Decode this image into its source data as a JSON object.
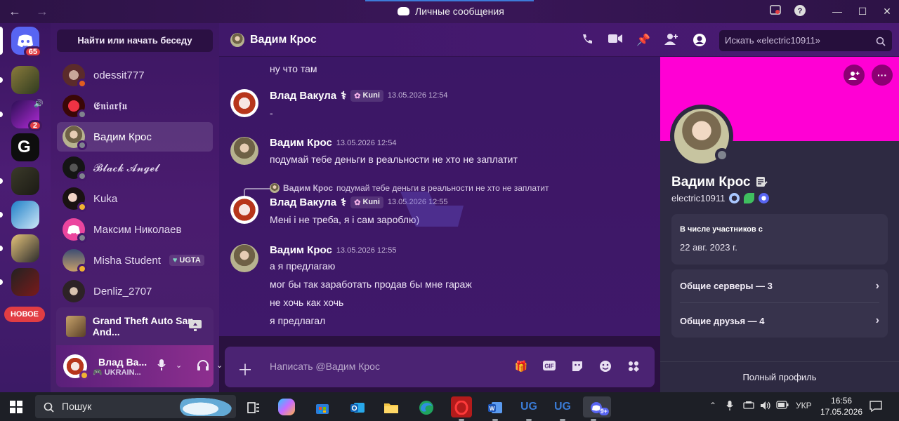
{
  "window": {
    "title": "Личные сообщения",
    "nav_back": "←",
    "nav_forward": "→"
  },
  "servers": {
    "home_badge": "65",
    "unread_badge": "2",
    "new_label": "НОВОЕ"
  },
  "dm_sidebar": {
    "search_label": "Найти или начать беседу",
    "items": [
      {
        "name": "odessit777"
      },
      {
        "name": "𝕰𝖓𝖎𝖆𝖗𝖋𝖚"
      },
      {
        "name": "Вадим Крос"
      },
      {
        "name": "𝓑𝓵𝓪𝓬𝓴 𝓐𝓷𝓰𝓮𝓵"
      },
      {
        "name": "Kuka"
      },
      {
        "name": "Максим Николаев"
      },
      {
        "name": "Misha Student",
        "tag": "UGTA"
      },
      {
        "name": "Denliz_2707"
      }
    ],
    "activity": "Grand Theft Auto San And...",
    "user": {
      "name": "Влад Ва...",
      "status": "UKRAIN..."
    }
  },
  "chat": {
    "recipient": "Вадим Крос",
    "search_placeholder": "Искать «electric10911»",
    "messages": [
      {
        "id": "m0",
        "text": "ну что там"
      },
      {
        "id": "m1",
        "author": "Влад Вакула",
        "author_symbol": "⚕",
        "tag": "Kuni",
        "time": "13.05.2026 12:54",
        "lines": [
          "-"
        ]
      },
      {
        "id": "m2",
        "author": "Вадим Крос",
        "time": "13.05.2026 12:54",
        "lines": [
          "подумай тебе деньги в реальности не хто не заплатит"
        ]
      },
      {
        "id": "m3",
        "reply_author": "Вадим Крос",
        "reply_text": "подумай тебе деньги в реальности не хто не заплатит",
        "author": "Влад Вакула",
        "author_symbol": "⚕",
        "tag": "Kuni",
        "time": "13.05.2026 12:55",
        "lines": [
          "Мені і не треба, я і сам зароблю)"
        ]
      },
      {
        "id": "m4",
        "author": "Вадим Крос",
        "time": "13.05.2026 12:55",
        "lines": [
          "а я предлагаю",
          "мог бы так заработать продав бы мне гараж",
          "не хочь как хочь",
          "я предлагал"
        ]
      }
    ],
    "composer_placeholder": "Написать @Вадим Крос"
  },
  "profile": {
    "display_name": "Вадим Крос",
    "username": "electric10911",
    "member_since_label": "В числе участников с",
    "member_since": "22 авг. 2023 г.",
    "mutual_servers": "Общие серверы — 3",
    "mutual_friends": "Общие друзья — 4",
    "full_profile": "Полный профиль",
    "banner_color": "#ff00d4"
  },
  "taskbar": {
    "search_placeholder": "Пошук",
    "language": "УКР",
    "time": "16:56",
    "date": "17.05.2026",
    "discord_badge": "9+"
  }
}
